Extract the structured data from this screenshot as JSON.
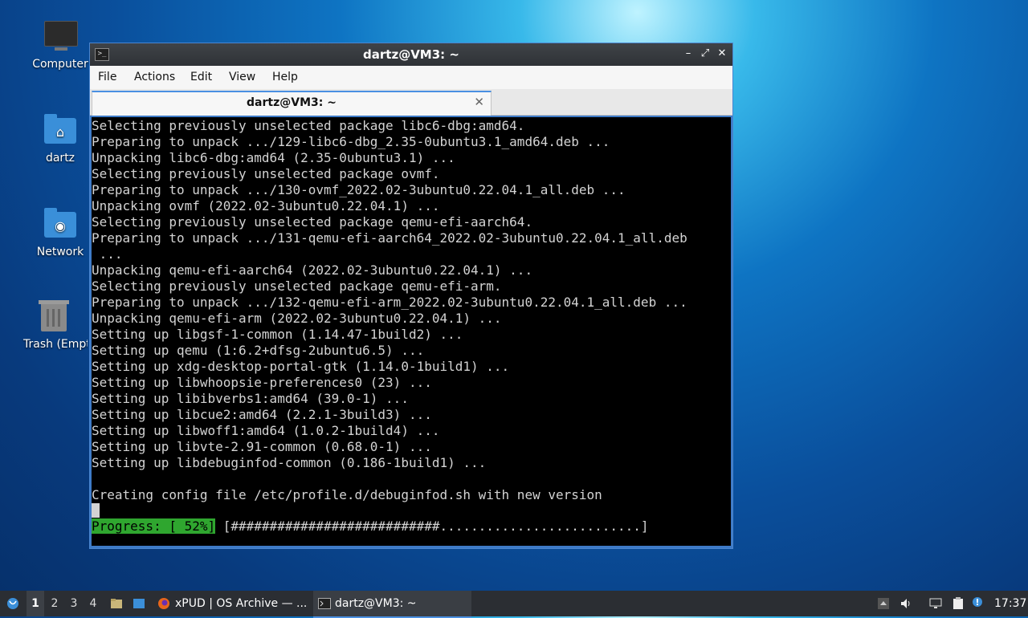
{
  "desktop": {
    "icons": [
      {
        "label": "Computer"
      },
      {
        "label": "dartz"
      },
      {
        "label": "Network"
      },
      {
        "label": "Trash (Empty)"
      }
    ]
  },
  "window": {
    "title": "dartz@VM3: ~",
    "controls": {
      "minimize": "–",
      "maximize": "⤢",
      "close": "✕"
    },
    "menu": [
      "File",
      "Actions",
      "Edit",
      "View",
      "Help"
    ],
    "tab": {
      "label": "dartz@VM3: ~",
      "close": "✕"
    }
  },
  "terminal": {
    "lines": [
      "Selecting previously unselected package libc6-dbg:amd64.",
      "Preparing to unpack .../129-libc6-dbg_2.35-0ubuntu3.1_amd64.deb ...",
      "Unpacking libc6-dbg:amd64 (2.35-0ubuntu3.1) ...",
      "Selecting previously unselected package ovmf.",
      "Preparing to unpack .../130-ovmf_2022.02-3ubuntu0.22.04.1_all.deb ...",
      "Unpacking ovmf (2022.02-3ubuntu0.22.04.1) ...",
      "Selecting previously unselected package qemu-efi-aarch64.",
      "Preparing to unpack .../131-qemu-efi-aarch64_2022.02-3ubuntu0.22.04.1_all.deb",
      " ...",
      "Unpacking qemu-efi-aarch64 (2022.02-3ubuntu0.22.04.1) ...",
      "Selecting previously unselected package qemu-efi-arm.",
      "Preparing to unpack .../132-qemu-efi-arm_2022.02-3ubuntu0.22.04.1_all.deb ...",
      "Unpacking qemu-efi-arm (2022.02-3ubuntu0.22.04.1) ...",
      "Setting up libgsf-1-common (1.14.47-1build2) ...",
      "Setting up qemu (1:6.2+dfsg-2ubuntu6.5) ...",
      "Setting up xdg-desktop-portal-gtk (1.14.0-1build1) ...",
      "Setting up libwhoopsie-preferences0 (23) ...",
      "Setting up libibverbs1:amd64 (39.0-1) ...",
      "Setting up libcue2:amd64 (2.2.1-3build3) ...",
      "Setting up libwoff1:amd64 (1.0.2-1build4) ...",
      "Setting up libvte-2.91-common (0.68.0-1) ...",
      "Setting up libdebuginfod-common (0.186-1build1) ...",
      "",
      "Creating config file /etc/profile.d/debuginfod.sh with new version"
    ],
    "progress_label": "Progress: [ 52%]",
    "progress_bar": " [###########################..........................]"
  },
  "taskbar": {
    "workspaces": [
      "1",
      "2",
      "3",
      "4"
    ],
    "tasks": [
      {
        "label": "xPUD | OS Archive — ..."
      },
      {
        "label": "dartz@VM3: ~"
      }
    ],
    "clock": "17:37"
  },
  "colors": {
    "progress_green": "#2fa62f",
    "accent_blue": "#4a90e2"
  }
}
